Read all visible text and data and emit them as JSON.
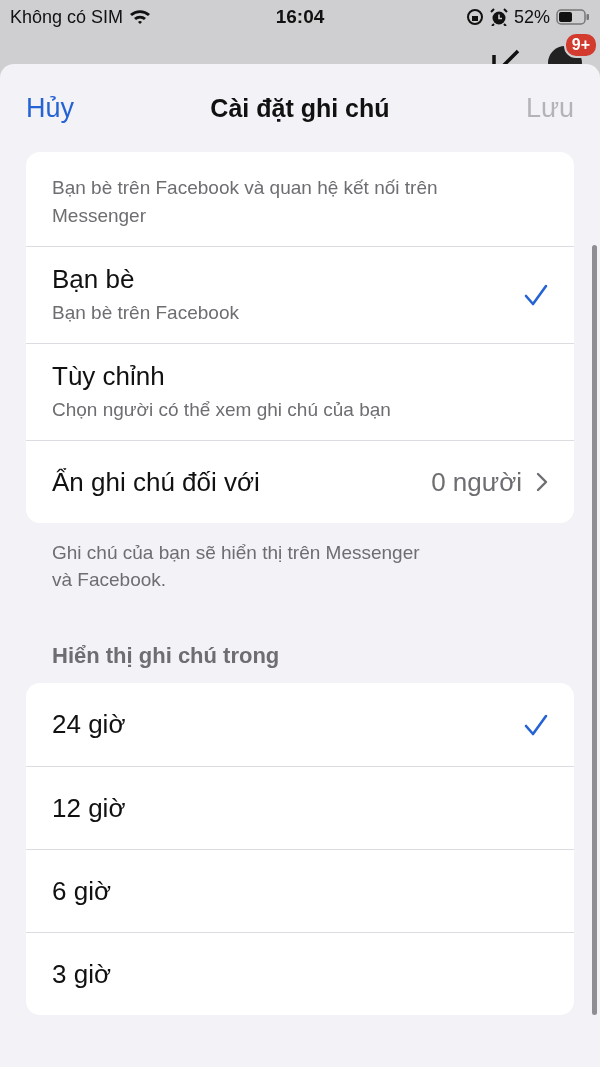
{
  "status_bar": {
    "carrier": "Không có SIM",
    "time": "16:04",
    "battery": "52%"
  },
  "background_app": {
    "badge": "9+"
  },
  "sheet": {
    "cancel": "Hủy",
    "title": "Cài đặt ghi chú",
    "save": {
      "label": "Lưu",
      "disabled": true
    }
  },
  "audience_options": [
    {
      "subtitle": "Bạn bè trên Facebook và quan hệ kết nối trên Messenger",
      "selected": false
    },
    {
      "title": "Bạn bè",
      "subtitle": "Bạn bè trên Facebook",
      "selected": true
    },
    {
      "title": "Tùy chỉnh",
      "subtitle": "Chọn người có thể xem ghi chú của bạn",
      "selected": false
    }
  ],
  "hide_from": {
    "label": "Ẩn ghi chú đối với",
    "value": "0 người"
  },
  "footer_note": "Ghi chú của bạn sẽ hiển thị trên Messenger và Facebook.",
  "duration_section": {
    "header": "Hiển thị ghi chú trong",
    "options": [
      {
        "label": "24 giờ",
        "selected": true
      },
      {
        "label": "12 giờ",
        "selected": false
      },
      {
        "label": "6 giờ",
        "selected": false
      },
      {
        "label": "3 giờ",
        "selected": false
      }
    ]
  }
}
